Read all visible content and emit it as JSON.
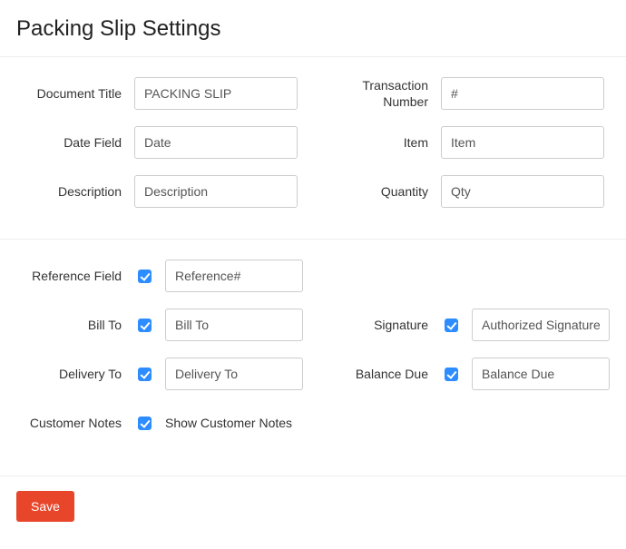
{
  "page": {
    "title": "Packing Slip Settings"
  },
  "labels": {
    "document_title": "Document Title",
    "transaction_number": "Transaction Number",
    "date_field": "Date Field",
    "item": "Item",
    "description": "Description",
    "quantity": "Quantity",
    "reference_field": "Reference Field",
    "bill_to": "Bill To",
    "delivery_to": "Delivery To",
    "customer_notes": "Customer Notes",
    "signature": "Signature",
    "balance_due": "Balance Due"
  },
  "values": {
    "document_title": "PACKING SLIP",
    "transaction_number": "#",
    "date_field": "Date",
    "item": "Item",
    "description": "Description",
    "quantity": "Qty",
    "reference_field": "Reference#",
    "bill_to": "Bill To",
    "delivery_to": "Delivery To",
    "signature": "Authorized Signature",
    "balance_due": "Balance Due"
  },
  "static_text": {
    "show_customer_notes": "Show Customer Notes"
  },
  "buttons": {
    "save": "Save"
  }
}
